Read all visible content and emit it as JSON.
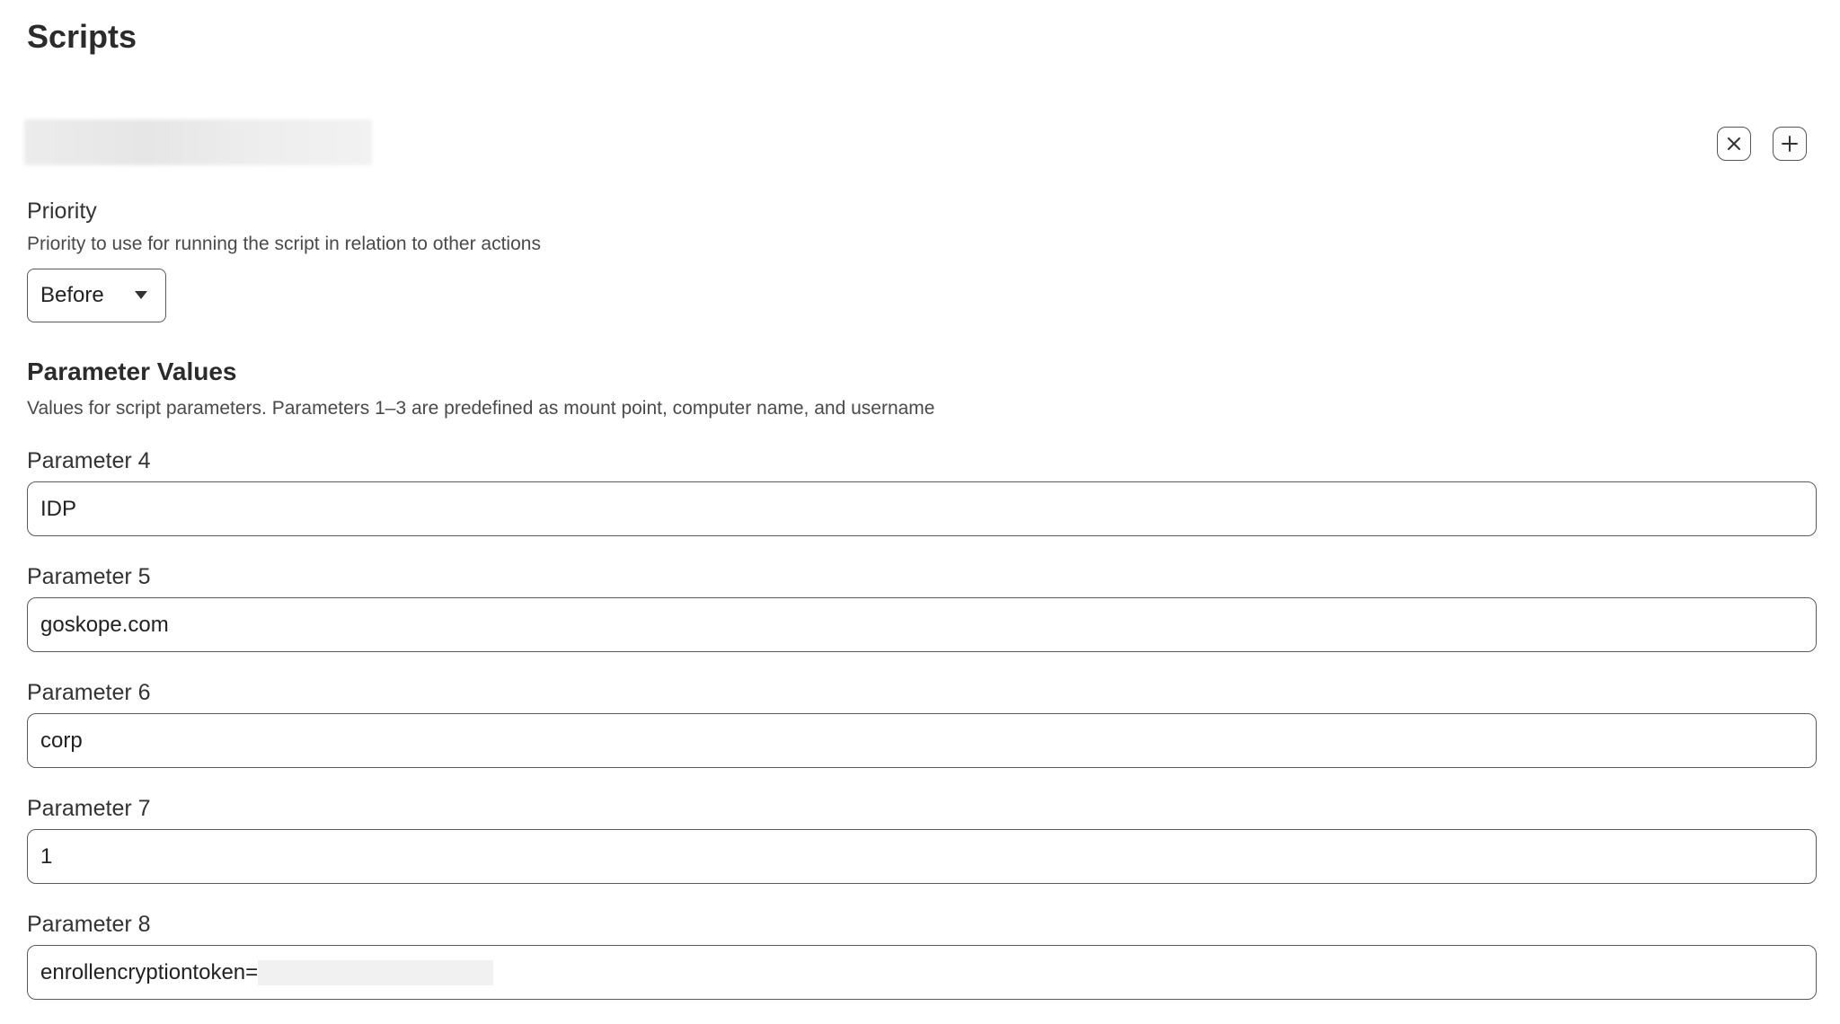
{
  "page": {
    "title": "Scripts"
  },
  "toolbar": {
    "remove_icon": "close-icon",
    "add_icon": "plus-icon"
  },
  "priority": {
    "label": "Priority",
    "helper": "Priority to use for running the script in relation to other actions",
    "selected": "Before"
  },
  "parameters": {
    "title": "Parameter Values",
    "helper": "Values for script parameters. Parameters 1–3 are predefined as mount point, computer name, and username",
    "items": [
      {
        "label": "Parameter 4",
        "value": "IDP"
      },
      {
        "label": "Parameter 5",
        "value": "goskope.com"
      },
      {
        "label": "Parameter 6",
        "value": "corp"
      },
      {
        "label": "Parameter 7",
        "value": "1"
      },
      {
        "label": "Parameter 8",
        "value": "enrollencryptiontoken="
      }
    ]
  }
}
